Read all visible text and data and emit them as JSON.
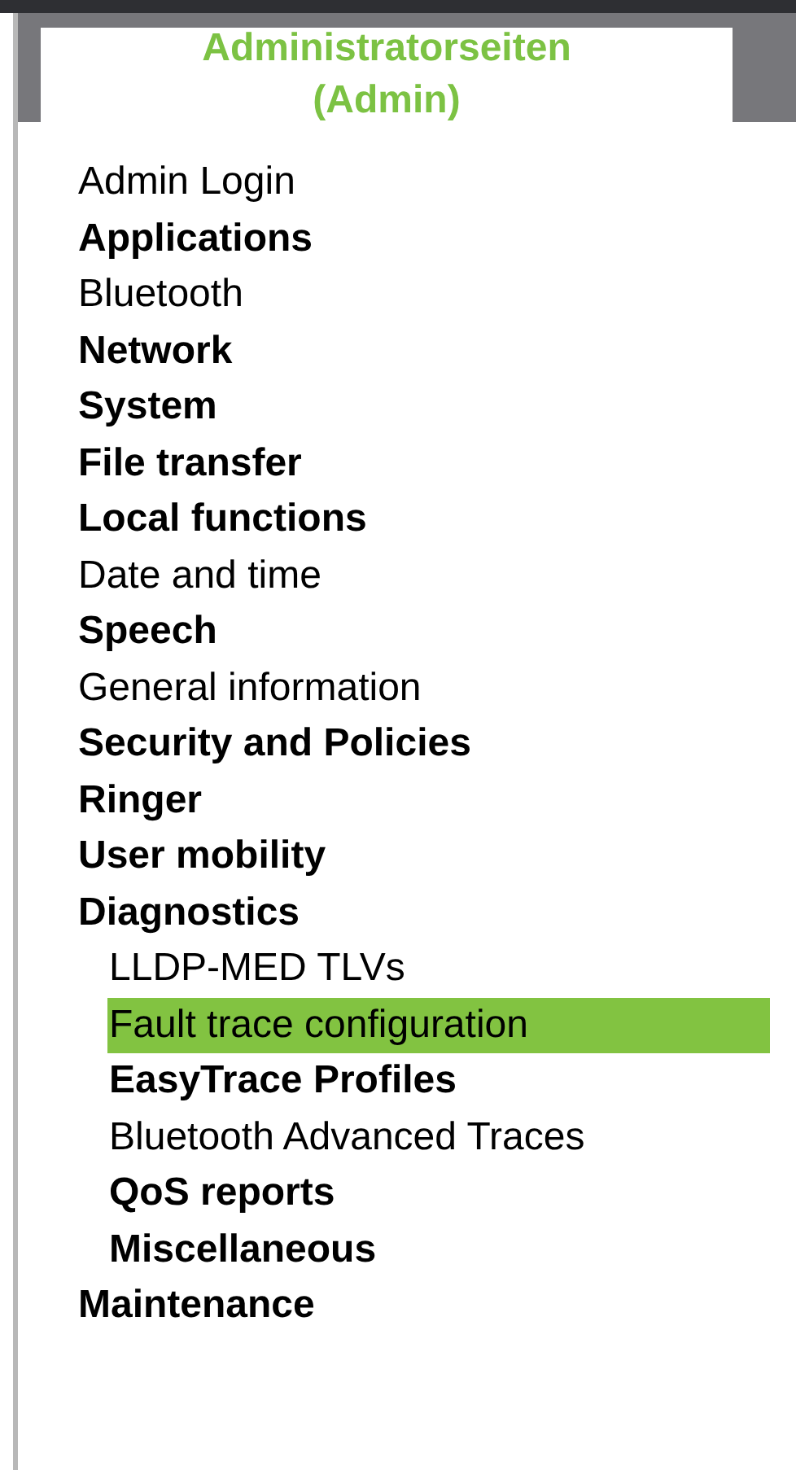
{
  "header": {
    "title": "Administratorseiten (Admin)"
  },
  "menu": [
    {
      "label": "Admin Login",
      "kind": "page",
      "selected": false
    },
    {
      "label": "Applications",
      "kind": "group",
      "selected": false
    },
    {
      "label": "Bluetooth",
      "kind": "page",
      "selected": false
    },
    {
      "label": "Network",
      "kind": "group",
      "selected": false
    },
    {
      "label": "System",
      "kind": "group",
      "selected": false
    },
    {
      "label": "File transfer",
      "kind": "group",
      "selected": false
    },
    {
      "label": "Local functions",
      "kind": "group",
      "selected": false
    },
    {
      "label": "Date and time",
      "kind": "page",
      "selected": false
    },
    {
      "label": "Speech",
      "kind": "group",
      "selected": false
    },
    {
      "label": "General information",
      "kind": "page",
      "selected": false
    },
    {
      "label": "Security and Policies",
      "kind": "group",
      "selected": false
    },
    {
      "label": "Ringer",
      "kind": "group",
      "selected": false
    },
    {
      "label": "User mobility",
      "kind": "group",
      "selected": false
    },
    {
      "label": "Diagnostics",
      "kind": "group",
      "selected": false,
      "children": [
        {
          "label": "LLDP-MED TLVs",
          "kind": "page",
          "selected": false
        },
        {
          "label": "Fault trace configuration",
          "kind": "page",
          "selected": true
        },
        {
          "label": "EasyTrace Profiles",
          "kind": "group",
          "selected": false
        },
        {
          "label": "Bluetooth Advanced Traces",
          "kind": "page",
          "selected": false
        },
        {
          "label": "QoS reports",
          "kind": "group",
          "selected": false
        },
        {
          "label": "Miscellaneous",
          "kind": "group",
          "selected": false
        }
      ]
    },
    {
      "label": "Maintenance",
      "kind": "group",
      "selected": false
    }
  ]
}
